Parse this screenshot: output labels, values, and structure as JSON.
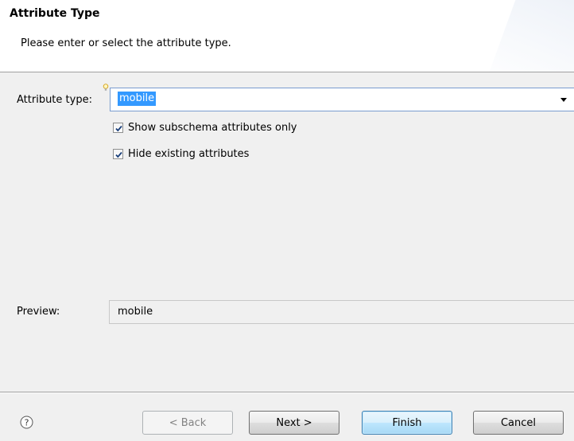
{
  "header": {
    "title": "Attribute Type",
    "description": "Please enter or select the attribute type."
  },
  "form": {
    "attribute_type_label": "Attribute type:",
    "attribute_type_value": "mobile",
    "show_subschema_label": "Show subschema attributes only",
    "show_subschema_checked": true,
    "hide_existing_label": "Hide existing attributes",
    "hide_existing_checked": true,
    "preview_label": "Preview:",
    "preview_value": "mobile"
  },
  "footer": {
    "help_icon": "help-icon",
    "back_label": "< Back",
    "next_label": "Next >",
    "finish_label": "Finish",
    "cancel_label": "Cancel"
  },
  "colors": {
    "selection": "#3399ff",
    "default_button": "#bee6fd"
  }
}
